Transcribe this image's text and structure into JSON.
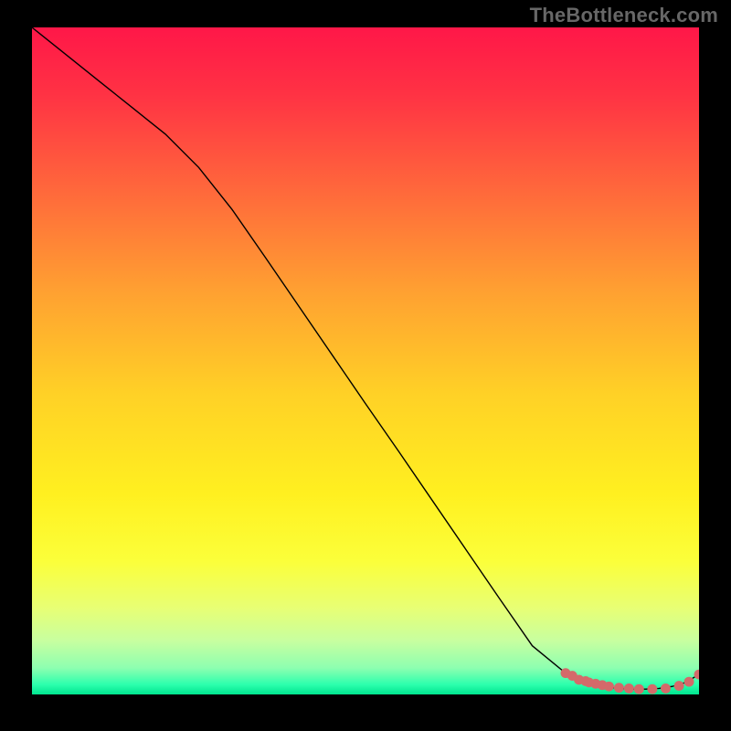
{
  "watermark": "TheBottleneck.com",
  "colors": {
    "frame_bg": "#000000",
    "watermark": "#676767",
    "curve": "#000000",
    "point_fill": "#d46a6a",
    "point_stroke": "#d46a6a"
  },
  "chart_data": {
    "type": "line",
    "title": "",
    "xlabel": "",
    "ylabel": "",
    "xlim": [
      0,
      100
    ],
    "ylim": [
      0,
      100
    ],
    "grid": false,
    "series": [
      {
        "name": "bottleneck-curve",
        "x": [
          0,
          5,
          10,
          15,
          20,
          25,
          30,
          35,
          40,
          45,
          50,
          55,
          60,
          65,
          70,
          75,
          80,
          82,
          84,
          86,
          88,
          90,
          92,
          94,
          96,
          98,
          100
        ],
        "y": [
          100,
          96,
          92,
          88,
          84,
          79,
          72.7,
          65.5,
          58.2,
          50.9,
          43.6,
          36.4,
          29.1,
          21.8,
          14.5,
          7.3,
          3.2,
          2.2,
          1.5,
          1.1,
          0.9,
          0.8,
          0.8,
          0.9,
          1.2,
          1.8,
          3.0
        ]
      }
    ],
    "points_overlay": {
      "name": "highlight-points",
      "x": [
        80,
        81,
        82,
        83,
        83.5,
        84.5,
        85.5,
        86.5,
        88,
        89.5,
        91,
        93,
        95,
        97,
        98.5,
        100
      ],
      "y": [
        3.2,
        2.8,
        2.2,
        2.0,
        1.8,
        1.6,
        1.4,
        1.2,
        1.0,
        0.9,
        0.8,
        0.8,
        0.9,
        1.3,
        1.9,
        3.0
      ]
    },
    "background_gradient_stops": [
      {
        "offset": 0.0,
        "color": "#ff1748"
      },
      {
        "offset": 0.1,
        "color": "#ff3244"
      },
      {
        "offset": 0.25,
        "color": "#ff6a3b"
      },
      {
        "offset": 0.4,
        "color": "#ffa231"
      },
      {
        "offset": 0.55,
        "color": "#ffd126"
      },
      {
        "offset": 0.7,
        "color": "#fff020"
      },
      {
        "offset": 0.8,
        "color": "#fbff3a"
      },
      {
        "offset": 0.87,
        "color": "#e8ff74"
      },
      {
        "offset": 0.92,
        "color": "#c7ffa0"
      },
      {
        "offset": 0.96,
        "color": "#8effb0"
      },
      {
        "offset": 0.985,
        "color": "#2dffad"
      },
      {
        "offset": 1.0,
        "color": "#00e58f"
      }
    ]
  }
}
